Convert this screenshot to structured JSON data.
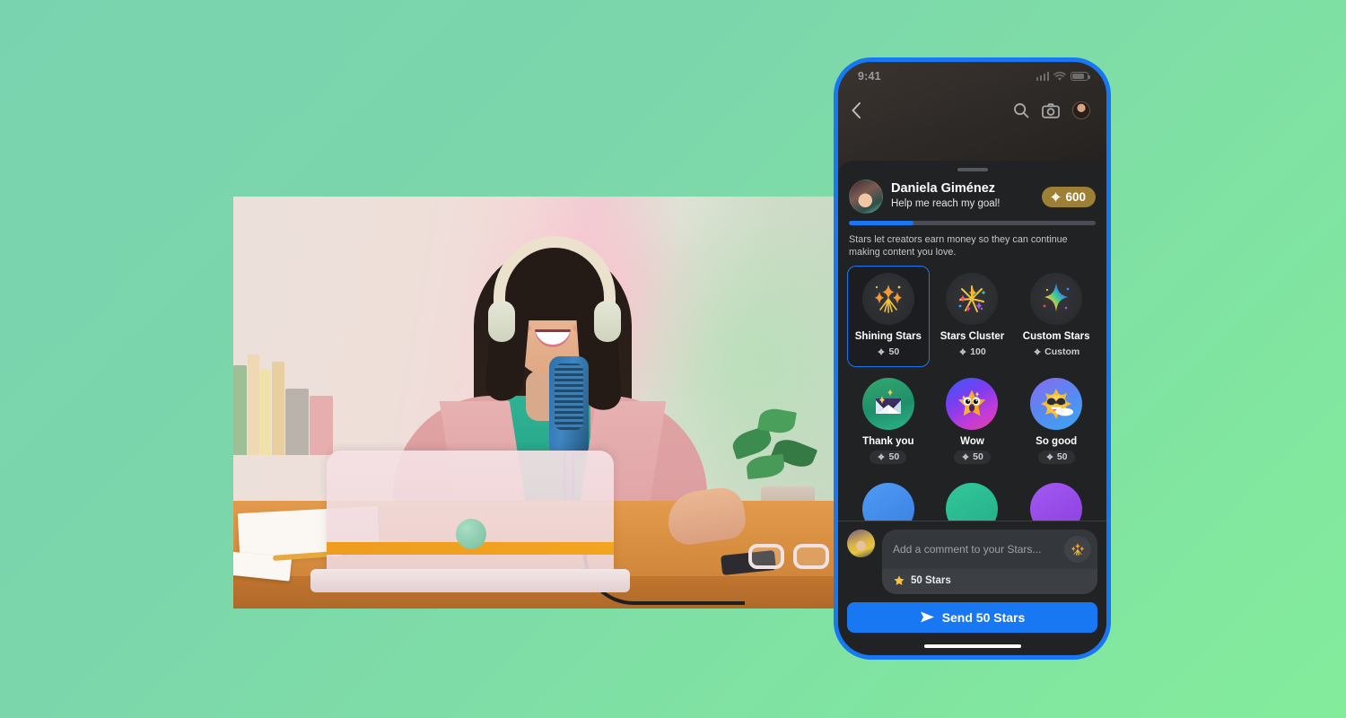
{
  "background": {
    "color_start": "#79d3ae",
    "color_end": "#83ec9b"
  },
  "hero_photo": {
    "name": "podcaster-photo",
    "description": "Woman with headphones smiling at desk with laptop and microphone"
  },
  "phone": {
    "frame_color": "#1877F2",
    "status_bar": {
      "time": "9:41",
      "icons": [
        "cellular-signal-icon",
        "wifi-icon",
        "battery-icon"
      ]
    },
    "top_nav": {
      "back": "back-icon",
      "actions": [
        "search-icon",
        "camera-icon",
        "profile-avatar"
      ]
    },
    "sheet": {
      "creator": {
        "name": "Daniela Giménez",
        "subtitle": "Help me reach my goal!",
        "coin_badge": "600",
        "progress_percent": 26
      },
      "blurb": "Stars let creators earn money so they can continue making content you love.",
      "gifts": [
        {
          "name": "Shining Stars",
          "price": "50",
          "selected": true,
          "icon": "shining-stars-icon"
        },
        {
          "name": "Stars Cluster",
          "price": "100",
          "selected": false,
          "icon": "stars-cluster-icon"
        },
        {
          "name": "Custom Stars",
          "price": "Custom",
          "selected": false,
          "icon": "custom-stars-icon"
        },
        {
          "name": "Thank you",
          "price": "50",
          "selected": false,
          "icon": "thank-you-envelope-icon"
        },
        {
          "name": "Wow",
          "price": "50",
          "selected": false,
          "icon": "wow-star-icon"
        },
        {
          "name": "So good",
          "price": "50",
          "selected": false,
          "icon": "so-good-sun-icon"
        }
      ],
      "composer": {
        "placeholder": "Add a comment to your Stars...",
        "amount_label": "50 Stars",
        "gift_icon": "stars-gift-icon"
      },
      "send_button": "Send 50 Stars"
    }
  }
}
